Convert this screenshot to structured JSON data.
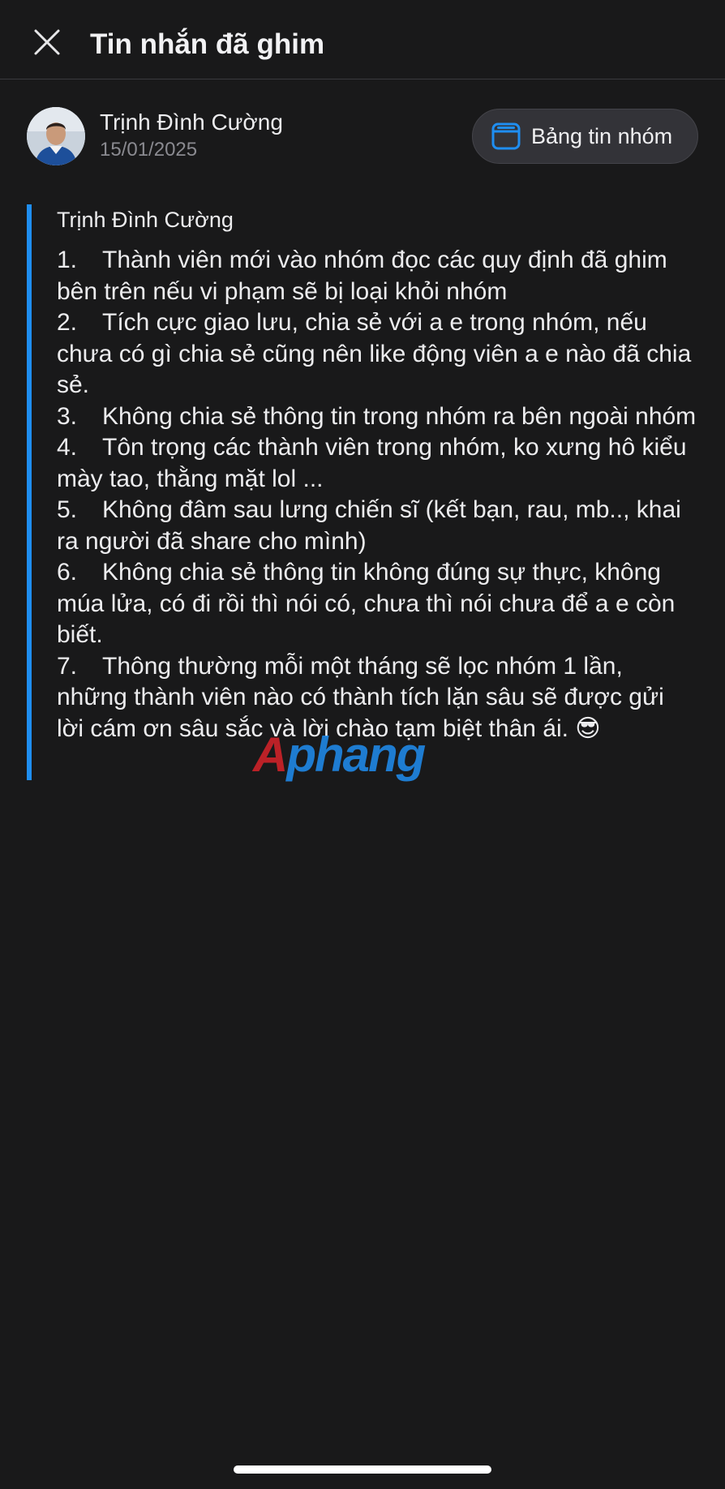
{
  "header": {
    "title": "Tin nhắn đã ghim",
    "close_icon": "close-icon"
  },
  "author": {
    "name": "Trịnh Đình Cường",
    "date": "15/01/2025"
  },
  "feed_button": {
    "label": "Bảng tin nhóm",
    "icon": "news-feed-icon",
    "icon_color": "#1f8ef1"
  },
  "message": {
    "sender": "Trịnh Đình Cường",
    "accent_color": "#1f8ef1",
    "items": [
      {
        "num": "1.",
        "text": "Thành viên mới vào nhóm đọc các quy định đã ghim bên trên nếu vi phạm sẽ bị loại khỏi nhóm"
      },
      {
        "num": "2.",
        "text": "Tích cực giao lưu, chia sẻ với a e trong nhóm, nếu chưa có gì chia sẻ cũng nên like động viên a e nào đã chia sẻ."
      },
      {
        "num": "3.",
        "text": "Không chia sẻ thông tin trong nhóm ra bên ngoài nhóm"
      },
      {
        "num": "4.",
        "text": "Tôn trọng các thành viên trong nhóm, ko xưng hô kiểu mày tao, thằng mặt lol ..."
      },
      {
        "num": "5.",
        "text": "Không đâm sau lưng chiến sĩ (kết bạn, rau, mb.., khai ra người đã share cho mình)"
      },
      {
        "num": "6.",
        "text": "Không chia sẻ thông tin không đúng sự thực, không múa lửa,  có đi rồi thì nói có, chưa thì nói chưa để a e còn biết."
      },
      {
        "num": "7.",
        "text": "Thông thường mỗi một tháng sẽ lọc nhóm 1 lần, những thành viên nào có thành tích lặn sâu sẽ được gửi lời cám ơn sâu sắc và lời chào tạm biệt thân ái. 😎"
      }
    ]
  },
  "watermark": {
    "first": "A",
    "rest": "phang"
  }
}
